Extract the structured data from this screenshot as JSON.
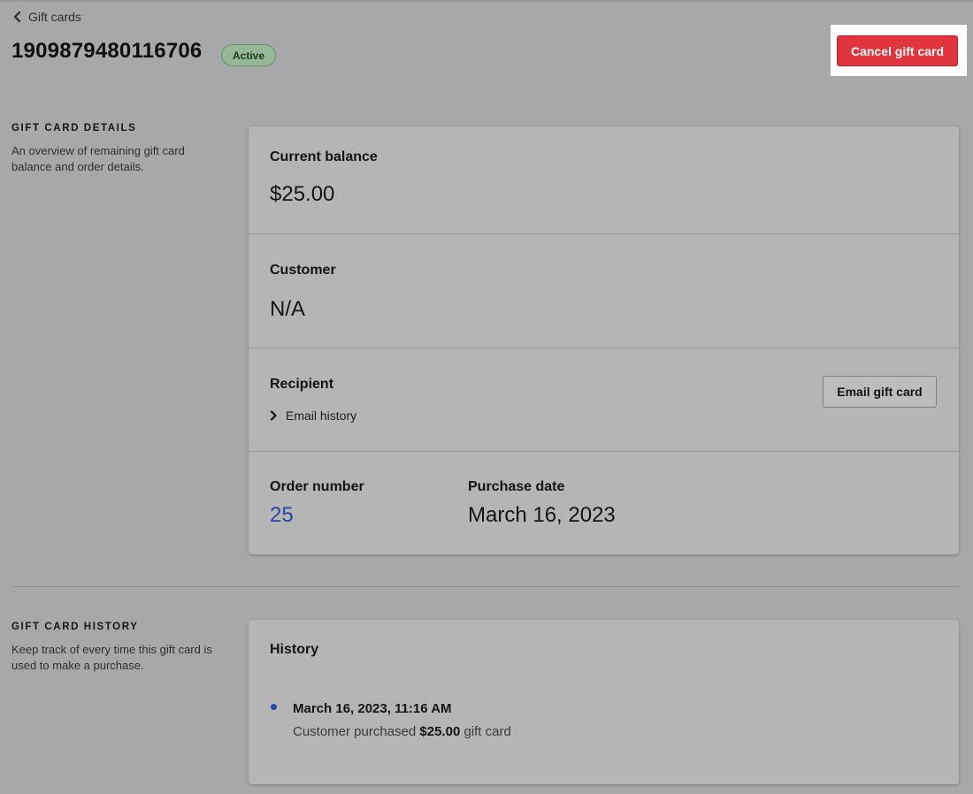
{
  "breadcrumb": {
    "label": "Gift cards",
    "icon": "chevron-left-icon"
  },
  "header": {
    "title": "1909879480116706",
    "status": "Active",
    "cancel_label": "Cancel gift card"
  },
  "details_section": {
    "heading": "GIFT CARD DETAILS",
    "description": "An overview of remaining gift card balance and order details."
  },
  "details_card": {
    "balance_label": "Current balance",
    "balance_value": "$25.00",
    "customer_label": "Customer",
    "customer_value": "N/A",
    "recipient_label": "Recipient",
    "email_history_label": "Email history",
    "email_button_label": "Email gift card",
    "order_number_label": "Order number",
    "order_number_value": "25",
    "purchase_date_label": "Purchase date",
    "purchase_date_value": "March 16, 2023"
  },
  "history_section": {
    "heading": "GIFT CARD HISTORY",
    "description": "Keep track of every time this gift card is used to make a purchase."
  },
  "history_card": {
    "title": "History",
    "entries": [
      {
        "date": "March 16, 2023, 11:16 AM",
        "text_before": "Customer purchased",
        "amount": "$25.00",
        "text_after": "gift card"
      }
    ]
  },
  "colors": {
    "accent_link": "#2747a6",
    "danger": "#e0343e",
    "badge_bg": "#96b896"
  }
}
